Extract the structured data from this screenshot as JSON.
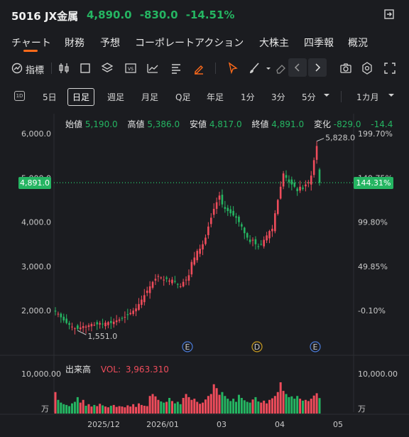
{
  "header": {
    "code": "5016",
    "name": "JX金属",
    "price": "4,890.0",
    "change": "-830.0",
    "change_pct": "-14.51%",
    "change_color": "#25b562"
  },
  "tabs": [
    "チャート",
    "財務",
    "予想",
    "コーポレートアクション",
    "大株主",
    "四季報",
    "概況"
  ],
  "active_tab": "チャート",
  "toolbar": {
    "indicator_label": "指標",
    "icons": [
      "pencil-icon",
      "candlestick-icon",
      "square-icon",
      "layers-icon",
      "vs-icon",
      "chart-compare-icon",
      "text-align-icon",
      "highlighter-icon",
      "cursor-icon",
      "brush-icon",
      "eraser-icon",
      "arrow-left-icon",
      "arrow-right-icon",
      "camera-icon",
      "settings-icon",
      "fullscreen-icon"
    ]
  },
  "periods": {
    "icon_label": "1D",
    "items": [
      "5日",
      "日足",
      "週足",
      "月足",
      "Q足",
      "年足",
      "1分",
      "3分",
      "5分",
      "1カ月"
    ],
    "active": "日足"
  },
  "ohlc": {
    "open_label": "始値",
    "open": "5,190.0",
    "high_label": "高値",
    "high": "5,386.0",
    "low_label": "安値",
    "low": "4,817.0",
    "close_label": "終値",
    "close": "4,891.0",
    "chg_label": "変化",
    "chg": "-829.0",
    "chg_pct": "-14.4"
  },
  "price_badge": "4,891.0",
  "pct_badge": "144.31%",
  "volume": {
    "label": "出来高",
    "vol_label": "VOL:",
    "vol_value": "3,963.310",
    "axis_label": "10,000.00",
    "unit": "万"
  },
  "chart_data": {
    "type": "candlestick",
    "y_left_ticks": [
      "6,000.0",
      "5,000.0",
      "4,000.0",
      "3,000.0",
      "2,000.0"
    ],
    "y_right_ticks": [
      "199.70%",
      "149.75%",
      "99.80%",
      "49.85%",
      "-0.10%"
    ],
    "x_ticks": [
      "2025/12",
      "2026/01",
      "03",
      "04",
      "05"
    ],
    "annotations": {
      "high": "5,828.0",
      "low": "1,551.0"
    },
    "event_markers": [
      "E",
      "D",
      "E"
    ],
    "colors": {
      "up": "#ef4c5b",
      "down": "#25b562",
      "marker_e": "#4a7bd8",
      "marker_d": "#c79a20"
    },
    "close_series": [
      1980,
      1930,
      1850,
      1780,
      1720,
      1680,
      1640,
      1600,
      1590,
      1620,
      1650,
      1640,
      1670,
      1700,
      1680,
      1690,
      1720,
      1700,
      1730,
      1740,
      1720,
      1750,
      1780,
      1800,
      1820,
      1860,
      1900,
      1950,
      2000,
      2050,
      2150,
      2250,
      2350,
      2450,
      2550,
      2650,
      2720,
      2780,
      2750,
      2700,
      2720,
      2680,
      2700,
      2650,
      2600,
      2550,
      2650,
      2700,
      2800,
      3100,
      3200,
      3350,
      3400,
      3500,
      3650,
      3900,
      4100,
      4300,
      4450,
      4600,
      4400,
      4300,
      4250,
      4200,
      4150,
      4100,
      4000,
      3900,
      3750,
      3650,
      3550,
      3600,
      3500,
      3450,
      3500,
      3600,
      3700,
      3800,
      3850,
      4200,
      4500,
      4800,
      5100,
      5000,
      4900,
      4850,
      4800,
      4700,
      4800,
      4750,
      4850,
      4900,
      5050,
      5400,
      5720,
      4891
    ],
    "volume_series": [
      5500,
      3500,
      2800,
      2400,
      2200,
      1900,
      2600,
      3000,
      4200,
      2800,
      3500,
      2000,
      2400,
      1800,
      2200,
      1900,
      2500,
      2100,
      1800,
      1600,
      2000,
      2200,
      1700,
      1900,
      1800,
      1600,
      2100,
      1800,
      2400,
      1700,
      2600,
      2200,
      2000,
      1900,
      4500,
      5000,
      4400,
      3500,
      3100,
      2800,
      3000,
      4000,
      3200,
      2600,
      3000,
      2400,
      4000,
      5000,
      4200,
      3500,
      3800,
      3000,
      2500,
      2800,
      3600,
      4500,
      5000,
      7500,
      6500,
      4800,
      5500,
      4500,
      3800,
      3200,
      3800,
      3000,
      4800,
      4000,
      3400,
      3000,
      2800,
      3600,
      4200,
      3100,
      2800,
      3300,
      2600,
      3500,
      3900,
      4500,
      5500,
      8000,
      5800,
      5000,
      4200,
      4400,
      3800,
      4500,
      3800,
      3300,
      3500,
      3200,
      3800,
      4600,
      5200,
      3963
    ]
  }
}
